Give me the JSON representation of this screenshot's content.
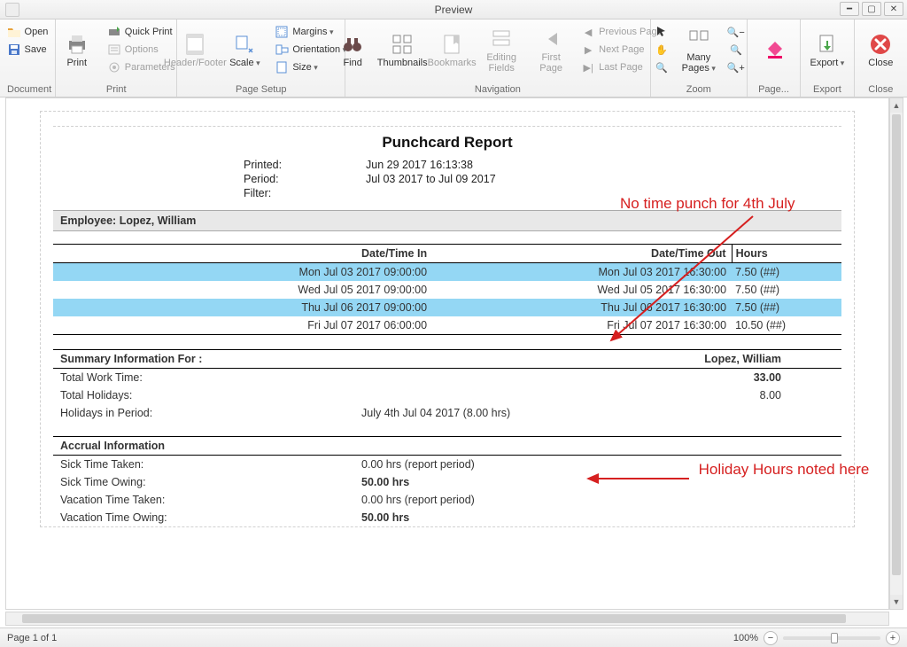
{
  "window": {
    "title": "Preview"
  },
  "ribbon": {
    "document": {
      "label": "Document",
      "open": "Open",
      "save": "Save"
    },
    "print": {
      "label": "Print",
      "print": "Print",
      "quickprint": "Quick Print",
      "options": "Options",
      "parameters": "Parameters"
    },
    "pagesetup": {
      "label": "Page Setup",
      "headerfooter": "Header/Footer",
      "scale": "Scale",
      "margins": "Margins",
      "orientation": "Orientation",
      "size": "Size"
    },
    "navigation": {
      "label": "Navigation",
      "find": "Find",
      "thumbnails": "Thumbnails",
      "bookmarks": "Bookmarks",
      "editing": "Editing Fields",
      "firstpage": "First Page",
      "prev": "Previous Page",
      "next": "Next Page",
      "last": "Last Page"
    },
    "zoom": {
      "label": "Zoom",
      "manypages": "Many Pages"
    },
    "pagebg": {
      "label": "Page..."
    },
    "export": {
      "label": "Export",
      "export": "Export"
    },
    "close": {
      "label": "Close",
      "close": "Close"
    }
  },
  "report": {
    "title": "Punchcard Report",
    "header": {
      "printed_label": "Printed:",
      "printed_value": "Jun 29 2017 16:13:38",
      "period_label": "Period:",
      "period_value": "Jul 03 2017 to Jul 09 2017",
      "filter_label": "Filter:",
      "filter_value": ""
    },
    "employee_label": "Employee:",
    "employee_name": "Lopez, William",
    "columns": {
      "in": "Date/Time In",
      "out": "Date/Time Out",
      "hours": "Hours"
    },
    "rows": [
      {
        "hl": true,
        "in": "Mon Jul 03 2017 09:00:00",
        "out": "Mon Jul 03 2017 16:30:00",
        "hours": "7.50 (##)"
      },
      {
        "hl": false,
        "in": "Wed Jul 05 2017 09:00:00",
        "out": "Wed Jul 05 2017 16:30:00",
        "hours": "7.50 (##)"
      },
      {
        "hl": true,
        "in": "Thu Jul 06 2017 09:00:00",
        "out": "Thu Jul 06 2017 16:30:00",
        "hours": "7.50 (##)"
      },
      {
        "hl": false,
        "in": "Fri Jul 07 2017 06:00:00",
        "out": "Fri Jul 07 2017 16:30:00",
        "hours": "10.50 (##)"
      }
    ],
    "summary": {
      "head_label": "Summary Information For :",
      "head_name": "Lopez, William",
      "work_label": "Total Work Time:",
      "work_value": "33.00",
      "holidays_label": "Total Holidays:",
      "holidays_value": "8.00",
      "hip_label": "Holidays in Period:",
      "hip_value": "July 4th Jul 04 2017 (8.00 hrs)"
    },
    "accrual": {
      "head": "Accrual Information",
      "stt_label": "Sick Time Taken:",
      "stt_value": "0.00 hrs (report period)",
      "sto_label": "Sick Time Owing:",
      "sto_value": "50.00 hrs",
      "vtt_label": "Vacation Time Taken:",
      "vtt_value": "0.00 hrs (report period)",
      "vto_label": "Vacation Time Owing:",
      "vto_value": "50.00 hrs"
    }
  },
  "annotations": {
    "a1": "No time punch for 4th July",
    "a2": "Holiday Hours noted here"
  },
  "status": {
    "page": "Page 1 of 1",
    "zoom": "100%"
  }
}
